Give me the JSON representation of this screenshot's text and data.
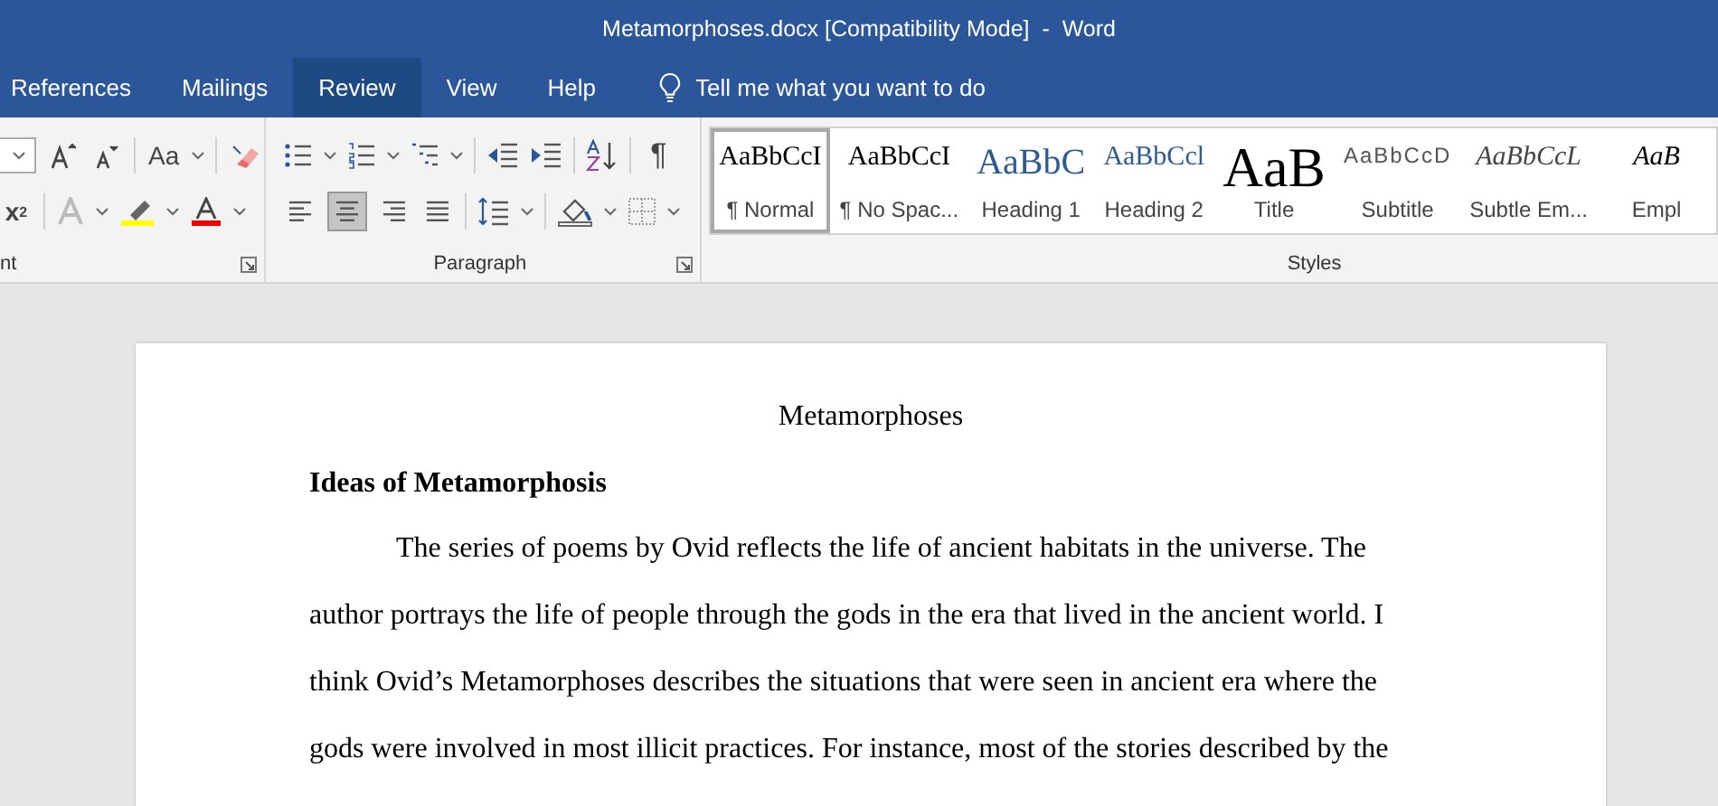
{
  "window": {
    "title": "Metamorphoses.docx [Compatibility Mode]  -  Word"
  },
  "tabs": [
    {
      "label": "References",
      "selected": false
    },
    {
      "label": "Mailings",
      "selected": false
    },
    {
      "label": "Review",
      "selected": true
    },
    {
      "label": "View",
      "selected": false
    },
    {
      "label": "Help",
      "selected": false
    }
  ],
  "tell_me": {
    "placeholder": "Tell me what you want to do"
  },
  "ribbon": {
    "font_group": {
      "label": "nt",
      "change_case": "Aa",
      "superscript": "x$^{2}$"
    },
    "paragraph_group": {
      "label": "Paragraph",
      "show_marks": "¶",
      "alignments": [
        {
          "kind": "left",
          "selected": false
        },
        {
          "kind": "center",
          "selected": true
        },
        {
          "kind": "right",
          "selected": false
        },
        {
          "kind": "justify",
          "selected": false
        }
      ]
    },
    "styles_group": {
      "label": "Styles",
      "styles": [
        {
          "kind": "normal",
          "preview": "AaBbCcI",
          "name": "¶ Normal",
          "selected": true
        },
        {
          "kind": "nospacing",
          "preview": "AaBbCcI",
          "name": "¶ No Spac...",
          "selected": false
        },
        {
          "kind": "heading1",
          "preview": "AaBbC",
          "name": "Heading 1",
          "selected": false
        },
        {
          "kind": "heading2",
          "preview": "AaBbCcl",
          "name": "Heading 2",
          "selected": false
        },
        {
          "kind": "title",
          "preview": "AaB",
          "name": "Title",
          "selected": false
        },
        {
          "kind": "subtitle",
          "preview": "AaBbCcD",
          "name": "Subtitle",
          "selected": false
        },
        {
          "kind": "subtle",
          "preview": "AaBbCcL",
          "name": "Subtle Em...",
          "selected": false
        },
        {
          "kind": "emphasis",
          "preview": "AaB",
          "name": "Empl",
          "selected": false
        }
      ]
    }
  },
  "document": {
    "title": "Metamorphoses",
    "heading": "Ideas of Metamorphosis",
    "paragraph": "The series of poems by Ovid reflects the life of ancient habitats in the universe. The author portrays the life of people through the gods in the era that lived in the ancient world. I think Ovid’s Metamorphoses describes the situations that were seen in ancient era where the gods were involved in most illicit practices. For instance, most of the stories described by the"
  }
}
